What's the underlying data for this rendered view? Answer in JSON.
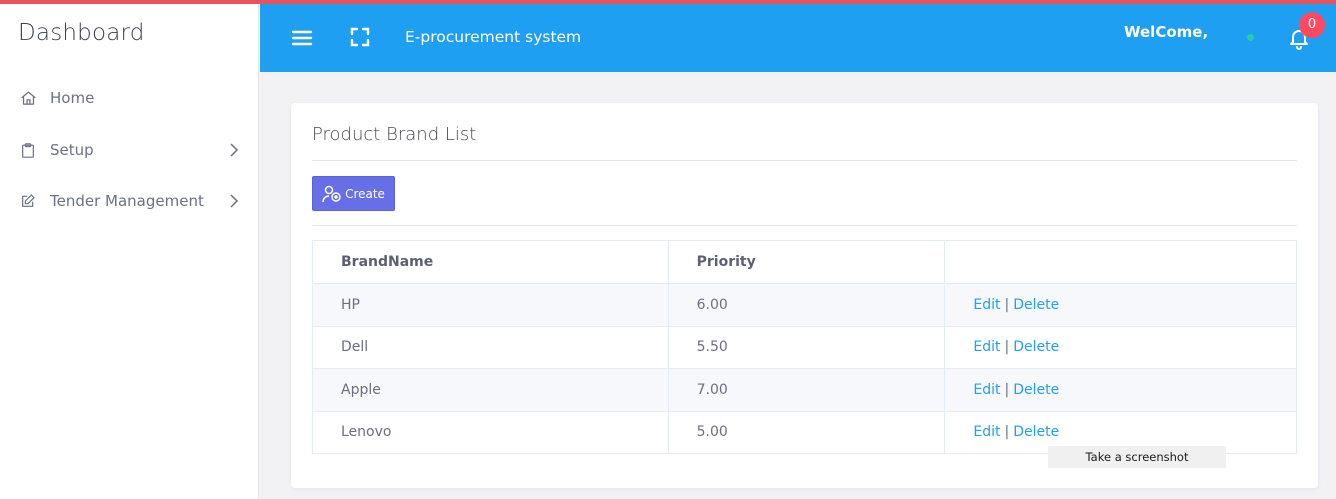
{
  "sidebar": {
    "brand": "Dashboard",
    "items": [
      {
        "label": "Home",
        "icon": "home-icon"
      },
      {
        "label": "Setup",
        "icon": "clipboard-icon"
      },
      {
        "label": "Tender Management",
        "icon": "edit-icon"
      }
    ]
  },
  "header": {
    "app_title": "E-procurement system",
    "welcome": "WelCome,",
    "notification_count": "0"
  },
  "main": {
    "card_title": "Product Brand List",
    "create_label": "Create",
    "table": {
      "columns": [
        "BrandName",
        "Priority",
        ""
      ],
      "rows": [
        {
          "brand": "HP",
          "priority": "6.00"
        },
        {
          "brand": "Dell",
          "priority": "5.50"
        },
        {
          "brand": "Apple",
          "priority": "7.00"
        },
        {
          "brand": "Lenovo",
          "priority": "5.00"
        }
      ],
      "edit_label": "Edit",
      "separator": "|",
      "delete_label": "Delete"
    }
  },
  "tooltip": "Take a screenshot",
  "colors": {
    "header_blue": "#1e9ff2",
    "create_button": "#666ee8",
    "badge_red": "#ff4961",
    "link_blue": "#1e9ff2",
    "status_green": "#28d094"
  }
}
